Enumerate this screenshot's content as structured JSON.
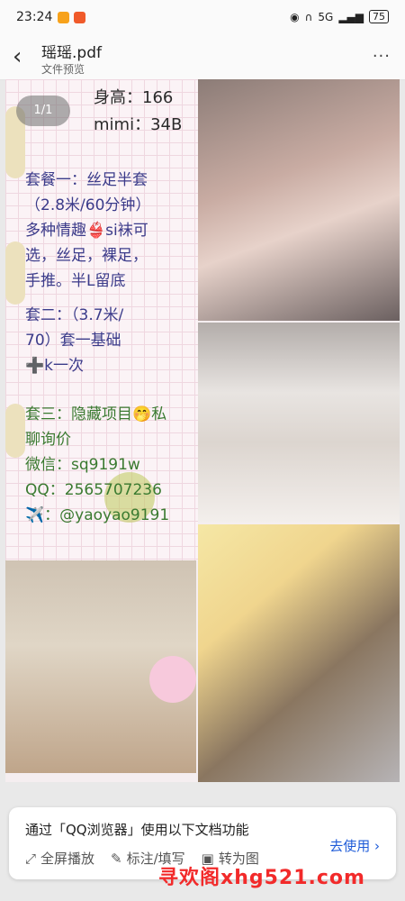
{
  "status": {
    "time": "23:24",
    "battery": "75",
    "net": "5G"
  },
  "header": {
    "title": "瑶瑶.pdf",
    "subtitle": "文件预览"
  },
  "doc": {
    "page_indicator": "1/1",
    "head_text": "身高：166\nmimi：34B",
    "para1": "套餐一：丝足半套\n（2.8米/60分钟）\n多种情趣👙si袜可\n选，丝足，裸足，\n手推。半L留底",
    "para2": "套二：（3.7米/\n70）套一基础\n➕k一次",
    "para3": "套三：隐藏项目🤭私\n聊询价\n微信：sq9191w\nQQ：2565707236\n✈️：@yaoyao9191"
  },
  "toast": {
    "line1": "通过「QQ浏览器」使用以下文档功能",
    "actions": [
      "全屏播放",
      "标注/填写",
      "转为图"
    ],
    "use_label": "去使用 ›"
  },
  "watermark": "寻欢阁xhg521.com",
  "colors": {
    "doc_text": "#3b3b8a",
    "link": "#1e5bd8",
    "watermark": "#f22a2a"
  }
}
